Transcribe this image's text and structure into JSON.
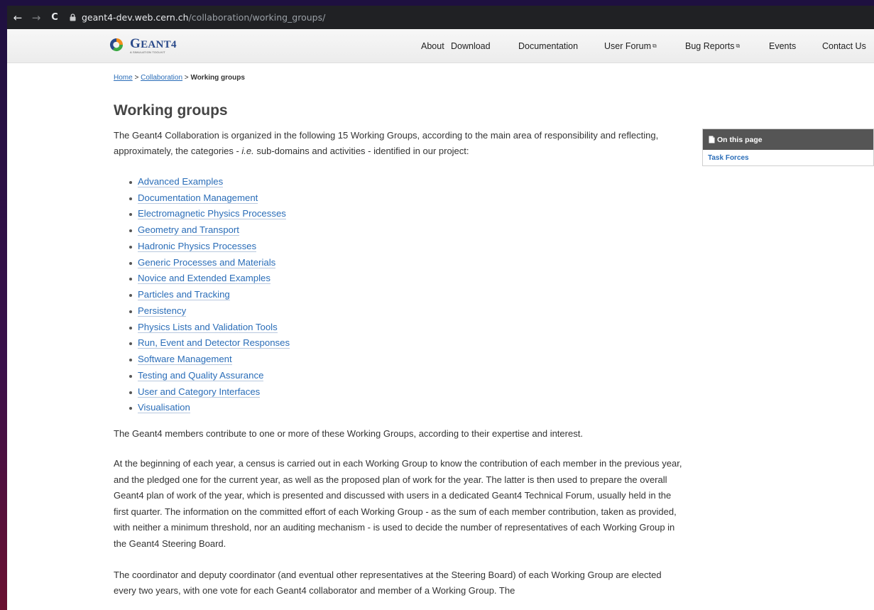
{
  "browser": {
    "url_host": "geant4-dev.web.cern.ch",
    "url_path": "/collaboration/working_groups/",
    "back_glyph": "←",
    "forward_glyph": "→",
    "reload_glyph": "C"
  },
  "header": {
    "logo_name_first": "G",
    "logo_name_rest": "EANT4",
    "logo_tagline": "A SIMULATION TOOLKIT",
    "nav": [
      {
        "label": "About",
        "external": false
      },
      {
        "label": "Download",
        "external": false
      },
      {
        "label": "Documentation",
        "external": false
      },
      {
        "label": "User Forum",
        "external": true
      },
      {
        "label": "Bug Reports",
        "external": true
      },
      {
        "label": "Events",
        "external": false
      },
      {
        "label": "Contact Us",
        "external": false
      }
    ],
    "external_glyph": "⧉"
  },
  "breadcrumb": {
    "home": "Home",
    "sep1": " > ",
    "collaboration": "Collaboration",
    "sep2": " > ",
    "current": "Working groups"
  },
  "main": {
    "title": "Working groups",
    "intro_before": "The Geant4 Collaboration is organized in the following 15 Working Groups, according to the main area of responsibility and reflecting, approximately, the categories - ",
    "intro_italic": "i.e.",
    "intro_after": " sub-domains and activities - identified in our project:",
    "groups": [
      "Advanced Examples",
      "Documentation Management",
      "Electromagnetic Physics Processes",
      "Geometry and Transport",
      "Hadronic Physics Processes",
      "Generic Processes and Materials",
      "Novice and Extended Examples",
      "Particles and Tracking",
      "Persistency",
      "Physics Lists and Validation Tools",
      "Run, Event and Detector Responses",
      "Software Management",
      "Testing and Quality Assurance",
      "User and Category Interfaces",
      "Visualisation"
    ],
    "para_members": "The Geant4 members contribute to one or more of these Working Groups, according to their expertise and interest.",
    "para_census": "At the beginning of each year, a census is carried out in each Working Group to know the contribution of each member in the previous year, and the pledged one for the current year, as well as the proposed plan of work for the year. The latter is then used to prepare the overall Geant4 plan of work of the year, which is presented and discussed with users in a dedicated Geant4 Technical Forum, usually held in the first quarter. The information on the committed effort of each Working Group - as the sum of each member contribution, taken as provided, with neither a minimum threshold, nor an auditing mechanism - is used to decide the number of representatives of each Working Group in the Geant4 Steering Board.",
    "para_coord": "The coordinator and deputy coordinator (and eventual other representatives at the Steering Board) of each Working Group are elected every two years, with one vote for each Geant4 collaborator and member of a Working Group. The"
  },
  "toc": {
    "title": "On this page",
    "links": [
      "Task Forces"
    ]
  },
  "colors": {
    "link": "#2a6db8",
    "toc_header": "#555555",
    "logo_blue": "#2a4a8a",
    "logo_orange": "#f28c1b",
    "logo_green": "#3aa843"
  },
  "icons": {
    "lock": "lock-icon",
    "toc": "document-icon",
    "logo": "geant4-logo-icon"
  }
}
